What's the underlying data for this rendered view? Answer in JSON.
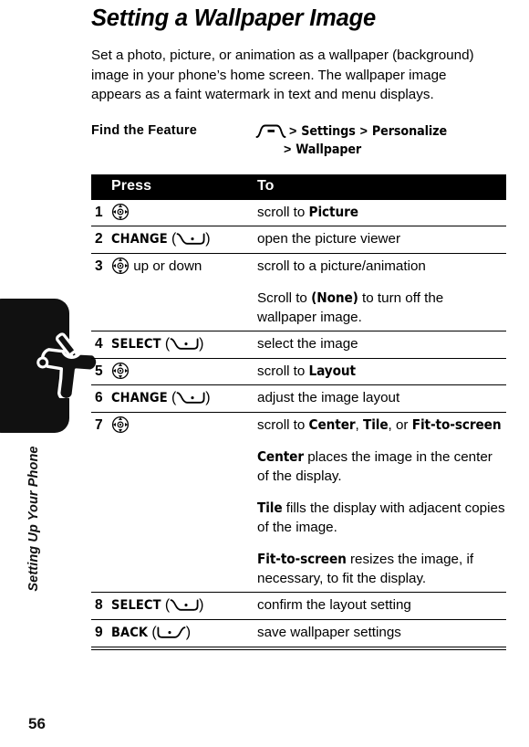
{
  "page": {
    "number": "56",
    "section_label": "Setting Up Your Phone",
    "section_icon": "wrench-screwdriver-icon"
  },
  "title": "Setting a Wallpaper Image",
  "intro": "Set a photo, picture, or animation as a wallpaper (background) image in your phone’s home screen. The wallpaper image appears as a faint watermark in text and menu displays.",
  "find_the_feature": {
    "label": "Find the Feature",
    "menu_icon": "menu-key-icon",
    "separator": ">",
    "path_line1": [
      "Settings",
      "Personalize"
    ],
    "path_line2": [
      "Wallpaper"
    ]
  },
  "steps_table": {
    "headers": {
      "num": "",
      "press": "Press",
      "to": "To"
    },
    "rows": [
      {
        "num": "1",
        "press_icon": "nav-key-icon",
        "press_key": "",
        "press_suffix": "",
        "to_prefix": "scroll to ",
        "to_bold": "Picture",
        "to_suffix": ""
      },
      {
        "num": "2",
        "press_icon": "left-softkey-icon",
        "press_key": "CHANGE",
        "press_suffix": "",
        "to_prefix": "open the picture viewer",
        "to_bold": "",
        "to_suffix": ""
      },
      {
        "num": "3",
        "press_icon": "nav-key-icon",
        "press_key": "",
        "press_suffix": " up or down",
        "to_prefix": "scroll to a picture/animation",
        "to_bold": "",
        "to_suffix": ""
      },
      {
        "num": "",
        "sub": true,
        "press_icon": "",
        "press_key": "",
        "press_suffix": "",
        "to_prefix": "Scroll to ",
        "to_bold": "(None)",
        "to_suffix": " to turn off the wallpaper image."
      },
      {
        "num": "4",
        "press_icon": "left-softkey-icon",
        "press_key": "SELECT",
        "press_suffix": "",
        "to_prefix": "select the image",
        "to_bold": "",
        "to_suffix": ""
      },
      {
        "num": "5",
        "press_icon": "nav-key-icon",
        "press_key": "",
        "press_suffix": "",
        "to_prefix": "scroll to ",
        "to_bold": "Layout",
        "to_suffix": ""
      },
      {
        "num": "6",
        "press_icon": "left-softkey-icon",
        "press_key": "CHANGE",
        "press_suffix": "",
        "to_prefix": "adjust the image layout",
        "to_bold": "",
        "to_suffix": ""
      },
      {
        "num": "7",
        "press_icon": "nav-key-icon",
        "press_key": "",
        "press_suffix": "",
        "to_prefix": "scroll to ",
        "to_bold": "Center",
        "to_mid": ", ",
        "to_bold2": "Tile",
        "to_mid2": ", or ",
        "to_bold3": "Fit-to-screen",
        "to_suffix": ""
      },
      {
        "num": "",
        "sub": true,
        "press_icon": "",
        "press_key": "",
        "press_suffix": "",
        "to_prefix": "",
        "to_bold": "Center",
        "to_suffix": " places the image in the center of the display."
      },
      {
        "num": "",
        "sub": true,
        "press_icon": "",
        "press_key": "",
        "press_suffix": "",
        "to_prefix": "",
        "to_bold": "Tile",
        "to_suffix": " fills the display with adjacent copies of the image."
      },
      {
        "num": "",
        "sub": true,
        "press_icon": "",
        "press_key": "",
        "press_suffix": "",
        "to_prefix": "",
        "to_bold": "Fit-to-screen",
        "to_suffix": " resizes the image, if necessary, to fit the display."
      },
      {
        "num": "8",
        "press_icon": "left-softkey-icon",
        "press_key": "SELECT",
        "press_suffix": "",
        "to_prefix": "confirm the layout setting",
        "to_bold": "",
        "to_suffix": ""
      },
      {
        "num": "9",
        "press_icon": "right-softkey-icon",
        "press_key": "BACK",
        "press_suffix": "",
        "to_prefix": "save wallpaper settings",
        "to_bold": "",
        "to_suffix": ""
      }
    ]
  },
  "colors": {
    "ink": "#000000",
    "paper": "#ffffff",
    "tab": "#111111"
  }
}
